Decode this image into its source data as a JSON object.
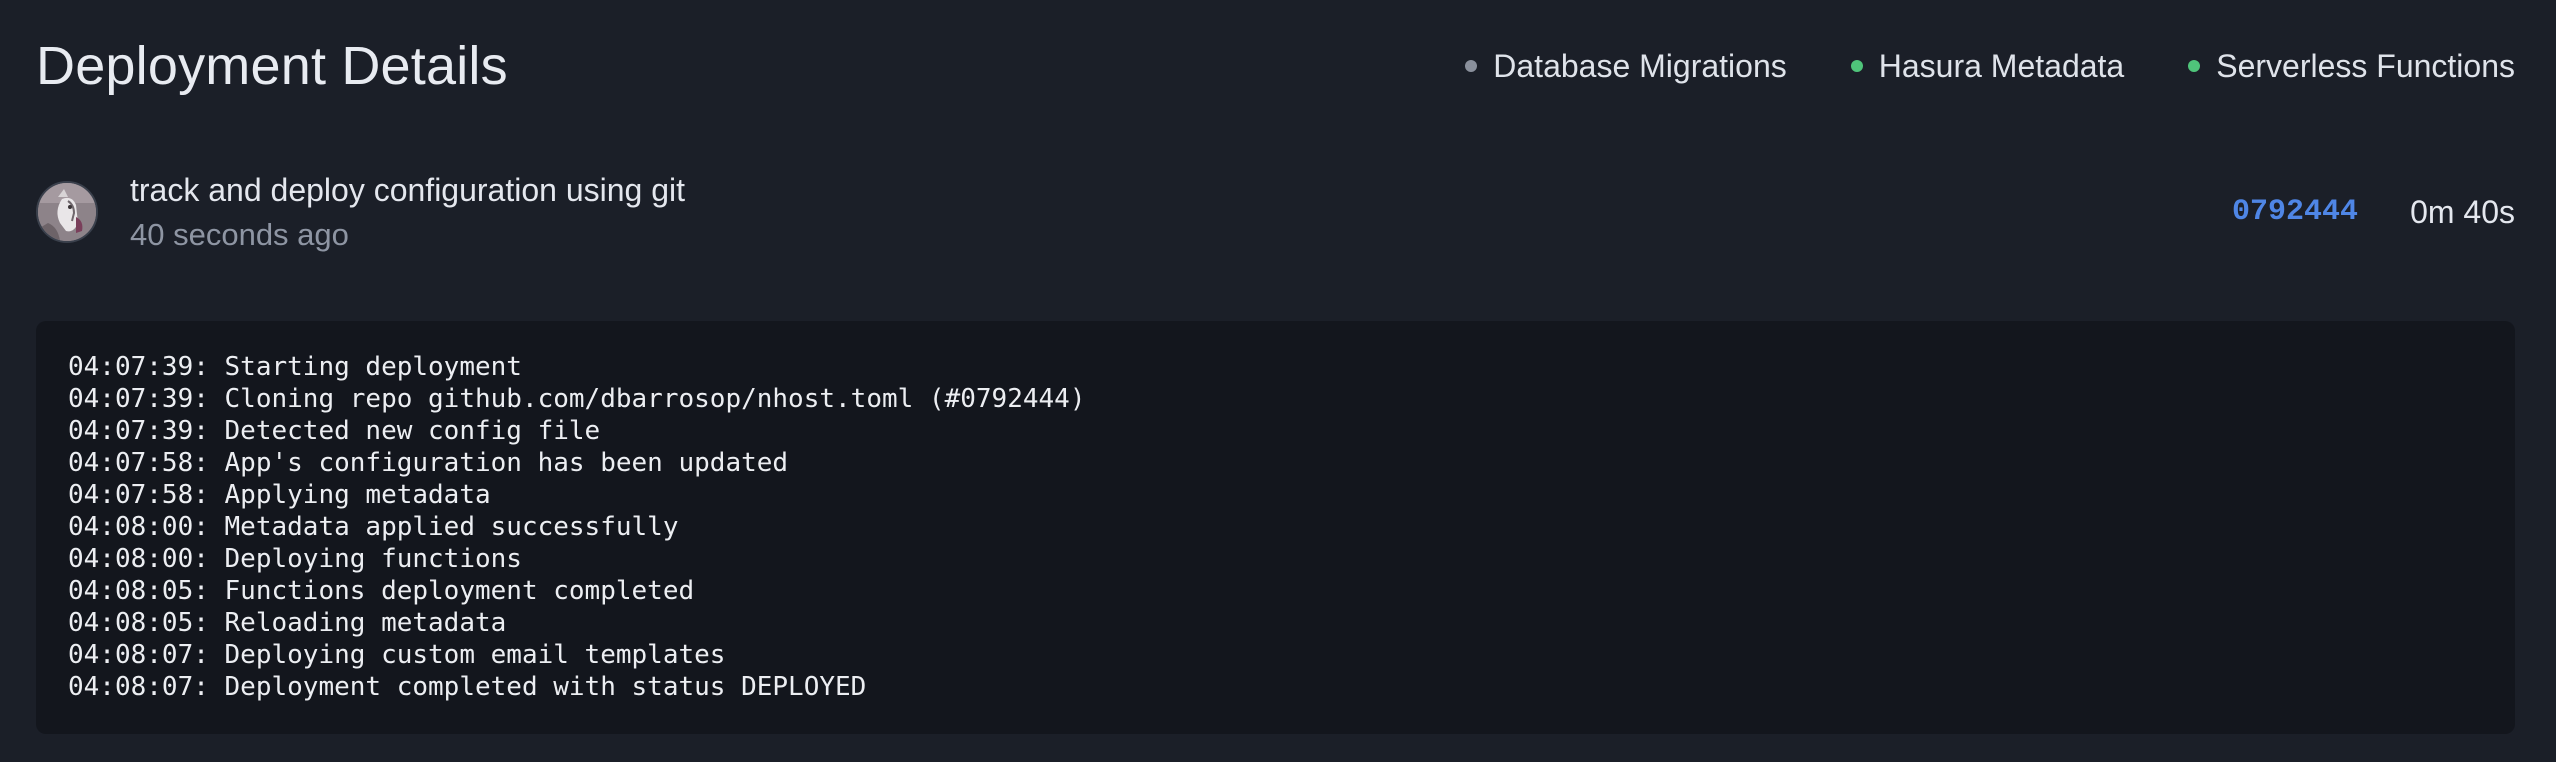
{
  "header": {
    "title": "Deployment Details",
    "statuses": [
      {
        "label": "Database Migrations",
        "color": "#8a909c"
      },
      {
        "label": "Hasura Metadata",
        "color": "#4fc47a"
      },
      {
        "label": "Serverless Functions",
        "color": "#4fc47a"
      }
    ]
  },
  "commit": {
    "message": "track and deploy configuration using git",
    "time_ago": "40 seconds ago",
    "hash": "0792444",
    "duration": "0m 40s",
    "avatar_icon": "user-avatar-icon"
  },
  "logs": [
    "04:07:39: Starting deployment",
    "04:07:39: Cloning repo github.com/dbarrosop/nhost.toml (#0792444)",
    "04:07:39: Detected new config file",
    "04:07:58: App's configuration has been updated",
    "04:07:58: Applying metadata",
    "04:08:00: Metadata applied successfully",
    "04:08:00: Deploying functions",
    "04:08:05: Functions deployment completed",
    "04:08:05: Reloading metadata",
    "04:08:07: Deploying custom email templates",
    "04:08:07: Deployment completed with status DEPLOYED"
  ]
}
